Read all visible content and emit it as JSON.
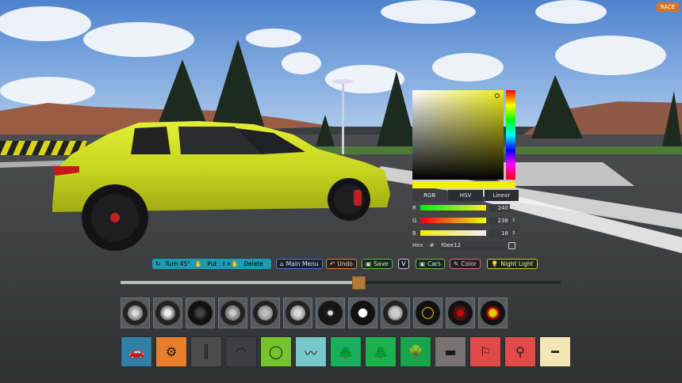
{
  "top_right": {
    "race_label": "RACE"
  },
  "color_picker": {
    "selected_color": "#f0ee12",
    "tabs": [
      {
        "label": "RGB",
        "active": true
      },
      {
        "label": "HSV",
        "active": false
      },
      {
        "label": "Linear",
        "active": false
      }
    ],
    "channels": [
      {
        "label": "R",
        "value": "240",
        "fraction": 0.94
      },
      {
        "label": "G",
        "value": "238",
        "fraction": 0.93
      },
      {
        "label": "B",
        "value": "18",
        "fraction": 0.07
      }
    ],
    "hex_label": "Hex",
    "hex_prefix": "#",
    "hex_value": "f0ee12"
  },
  "toolbar": {
    "turn_label": "Turn 45°",
    "put_label": "Put",
    "delete_label": "Delete",
    "main_menu_label": "Main Menu",
    "undo_label": "Undo",
    "save_label": "Save",
    "v_label": "V",
    "cars_label": "Cars",
    "color_label": "Color",
    "night_light_label": "Night Light"
  },
  "timeline": {
    "position_fraction": 0.54
  },
  "wheels": [
    {
      "name": "wheel-1"
    },
    {
      "name": "wheel-2"
    },
    {
      "name": "wheel-3"
    },
    {
      "name": "wheel-4"
    },
    {
      "name": "wheel-5"
    },
    {
      "name": "wheel-6"
    },
    {
      "name": "wheel-7"
    },
    {
      "name": "wheel-8"
    },
    {
      "name": "wheel-9"
    },
    {
      "name": "wheel-10"
    },
    {
      "name": "wheel-11"
    },
    {
      "name": "wheel-12"
    }
  ],
  "objects": [
    {
      "name": "car",
      "bg": "#2f7fa6"
    },
    {
      "name": "wheel",
      "bg": "#e77e2b"
    },
    {
      "name": "road-straight",
      "bg": "#4a4c50"
    },
    {
      "name": "road-curve",
      "bg": "#3c3e44"
    },
    {
      "name": "track-loop",
      "bg": "#74c42d"
    },
    {
      "name": "track-piece",
      "bg": "#78c7cc"
    },
    {
      "name": "tree-pine",
      "bg": "#19b05b"
    },
    {
      "name": "tree-fir",
      "bg": "#1bb14e"
    },
    {
      "name": "bush",
      "bg": "#1aa34d"
    },
    {
      "name": "rock",
      "bg": "#787272"
    },
    {
      "name": "barrier",
      "bg": "#e24a4a"
    },
    {
      "name": "lamp-post",
      "bg": "#e24a4a"
    },
    {
      "name": "sign-plank",
      "bg": "#f5e6b8"
    }
  ]
}
